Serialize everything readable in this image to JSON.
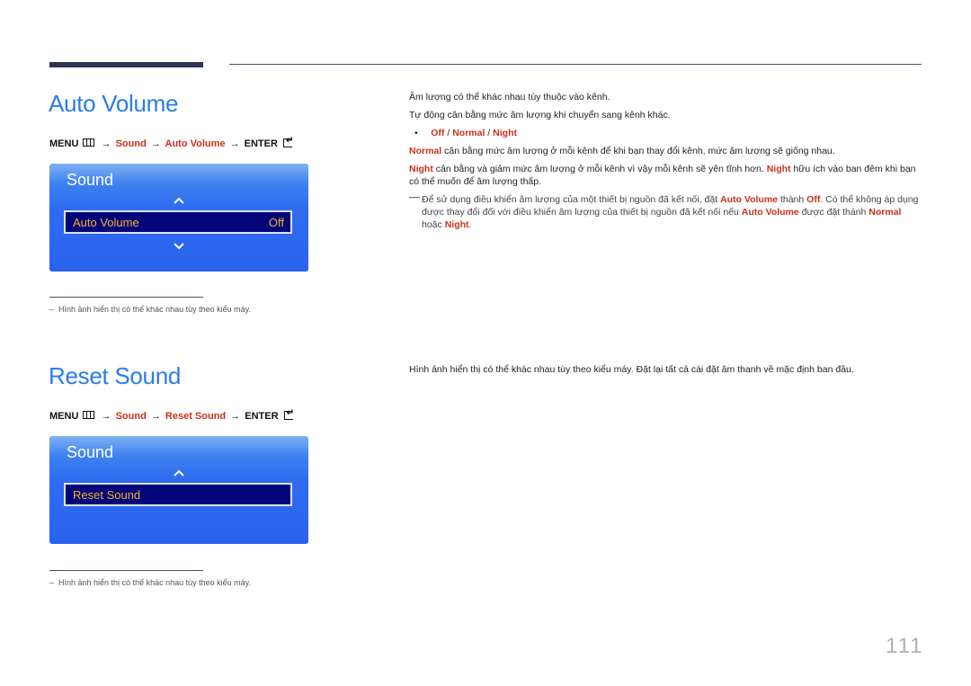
{
  "page_number": "111",
  "sections": [
    {
      "title": "Auto Volume",
      "menu_path": {
        "menu": "MENU",
        "arrow": "→",
        "sound": "Sound",
        "item": "Auto Volume",
        "enter": "ENTER"
      },
      "osd": {
        "header": "Sound",
        "selected_label": "Auto Volume",
        "selected_value": "Off",
        "has_up": true,
        "has_down": true
      },
      "footnote": "Hình ảnh hiển thị có thể khác nhau tùy theo kiểu máy.",
      "desc": {
        "line1": "Âm lượng có thể khác nhau tùy thuộc vào kênh.",
        "line2": "Tự động cân bằng mức âm lượng khi chuyển sang kênh khác.",
        "options": {
          "off": "Off",
          "sep": " / ",
          "normal": "Normal",
          "night": "Night"
        },
        "normal_term": "Normal",
        "normal_text": " cân bằng mức âm lượng ở mỗi kênh để khi bạn thay đổi kênh, mức âm lượng sẽ giống nhau.",
        "night_term": "Night",
        "night_text_1": " cân bằng và giảm mức âm lượng ở mỗi kênh vì vậy mỗi kênh sẽ yên tĩnh hơn. ",
        "night_term_2": "Night",
        "night_text_2": " hữu ích vào ban đêm khi bạn có thể muốn để âm lượng thấp.",
        "note_p1": "Để sử dụng điều khiển âm lượng của một thiết bị nguồn đã kết nối, đặt ",
        "note_t1": "Auto Volume",
        "note_p2": " thành ",
        "note_t2": "Off",
        "note_p3": ". Có thể không áp dụng được thay đổi đối với điều khiển âm lượng của thiết bị nguồn đã kết nối nếu ",
        "note_t3": "Auto Volume",
        "note_p4": " được đặt thành ",
        "note_t4": "Normal",
        "note_p5": " hoặc ",
        "note_t5": "Night",
        "note_p6": "."
      }
    },
    {
      "title": "Reset Sound",
      "menu_path": {
        "menu": "MENU",
        "arrow": "→",
        "sound": "Sound",
        "item": "Reset Sound",
        "enter": "ENTER"
      },
      "osd": {
        "header": "Sound",
        "selected_label": "Reset Sound",
        "has_up": true,
        "has_down": false
      },
      "footnote": "Hình ảnh hiển thị có thể khác nhau tùy theo kiểu máy.",
      "desc": {
        "line1": "Hình ảnh hiển thị có thể khác nhau tùy theo kiểu máy. Đặt lại tất cả cài đặt âm thanh về mặc định ban đầu."
      }
    }
  ],
  "colors": {
    "heading_blue": "#2b7ce8",
    "term_red": "#c8321c",
    "osd_highlight": "#05057a",
    "osd_text": "#f0b428"
  }
}
